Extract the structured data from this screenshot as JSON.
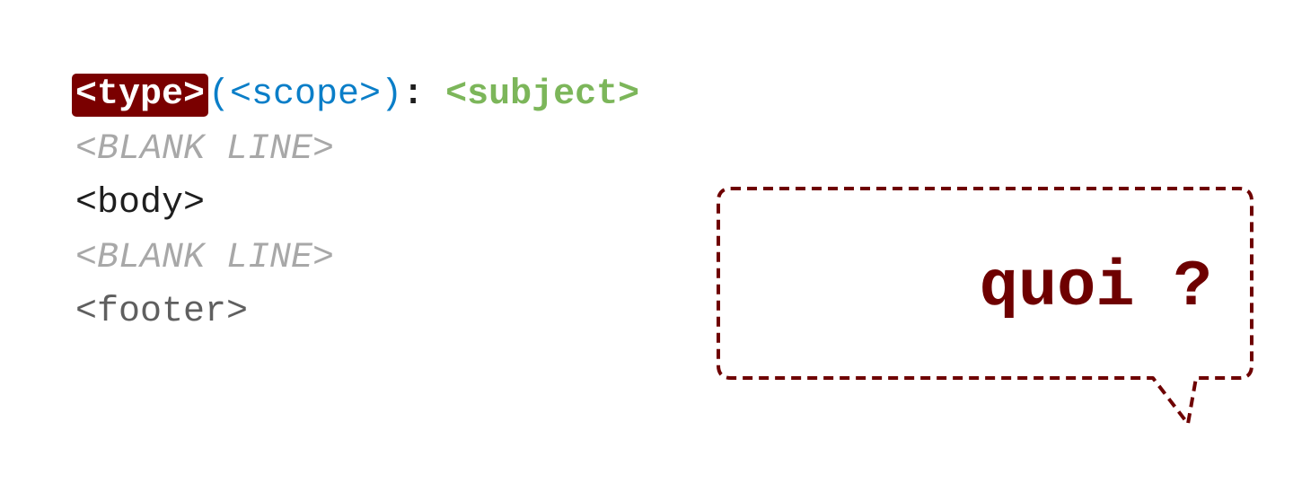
{
  "code": {
    "type_token": "<type>",
    "scope_token": "(<scope>)",
    "colon_token": ": ",
    "subject_token": "<subject>",
    "blank_line_1": "<BLANK LINE>",
    "body_line": "<body>",
    "blank_line_2": "<BLANK LINE>",
    "footer_line": "<footer>"
  },
  "callout": {
    "text": "quoi ?"
  },
  "colors": {
    "type_highlight": "#7a0000",
    "scope": "#0a7ec8",
    "subject": "#7cb65a",
    "blank_line": "#a8a8a8",
    "callout_border": "#6e0000"
  }
}
